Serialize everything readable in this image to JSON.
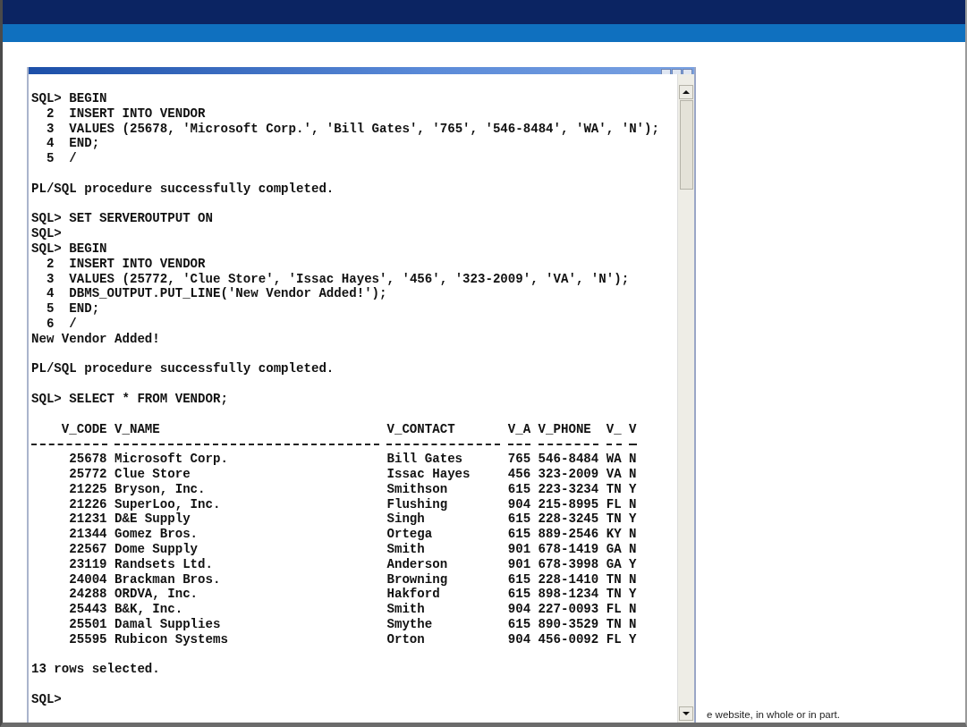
{
  "console": {
    "lines": [
      {
        "kind": "line",
        "text": "SQL> BEGIN"
      },
      {
        "kind": "line",
        "text": "  2  INSERT INTO VENDOR"
      },
      {
        "kind": "line",
        "text": "  3  VALUES (25678, 'Microsoft Corp.', 'Bill Gates', '765', '546-8484', 'WA', 'N');"
      },
      {
        "kind": "line",
        "text": "  4  END;"
      },
      {
        "kind": "line",
        "text": "  5  /"
      },
      {
        "kind": "blank"
      },
      {
        "kind": "line",
        "text": "PL/SQL procedure successfully completed."
      },
      {
        "kind": "blank"
      },
      {
        "kind": "line",
        "text": "SQL> SET SERVEROUTPUT ON"
      },
      {
        "kind": "line",
        "text": "SQL>"
      },
      {
        "kind": "line",
        "text": "SQL> BEGIN"
      },
      {
        "kind": "line",
        "text": "  2  INSERT INTO VENDOR"
      },
      {
        "kind": "line",
        "text": "  3  VALUES (25772, 'Clue Store', 'Issac Hayes', '456', '323-2009', 'VA', 'N');"
      },
      {
        "kind": "line",
        "text": "  4  DBMS_OUTPUT.PUT_LINE('New Vendor Added!');"
      },
      {
        "kind": "line",
        "text": "  5  END;"
      },
      {
        "kind": "line",
        "text": "  6  /"
      },
      {
        "kind": "line",
        "text": "New Vendor Added!"
      },
      {
        "kind": "blank"
      },
      {
        "kind": "line",
        "text": "PL/SQL procedure successfully completed."
      },
      {
        "kind": "blank"
      },
      {
        "kind": "line",
        "text": "SQL> SELECT * FROM VENDOR;"
      },
      {
        "kind": "blank"
      },
      {
        "kind": "table",
        "columns": [
          "V_CODE",
          "V_NAME",
          "V_CONTACT",
          "V_A",
          "V_PHONE",
          "V_",
          "V"
        ],
        "rows": [
          [
            "25678",
            "Microsoft Corp.",
            "Bill Gates",
            "765",
            "546-8484",
            "WA",
            "N"
          ],
          [
            "25772",
            "Clue Store",
            "Issac Hayes",
            "456",
            "323-2009",
            "VA",
            "N"
          ],
          [
            "21225",
            "Bryson, Inc.",
            "Smithson",
            "615",
            "223-3234",
            "TN",
            "Y"
          ],
          [
            "21226",
            "SuperLoo, Inc.",
            "Flushing",
            "904",
            "215-8995",
            "FL",
            "N"
          ],
          [
            "21231",
            "D&E Supply",
            "Singh",
            "615",
            "228-3245",
            "TN",
            "Y"
          ],
          [
            "21344",
            "Gomez Bros.",
            "Ortega",
            "615",
            "889-2546",
            "KY",
            "N"
          ],
          [
            "22567",
            "Dome Supply",
            "Smith",
            "901",
            "678-1419",
            "GA",
            "N"
          ],
          [
            "23119",
            "Randsets Ltd.",
            "Anderson",
            "901",
            "678-3998",
            "GA",
            "Y"
          ],
          [
            "24004",
            "Brackman Bros.",
            "Browning",
            "615",
            "228-1410",
            "TN",
            "N"
          ],
          [
            "24288",
            "ORDVA, Inc.",
            "Hakford",
            "615",
            "898-1234",
            "TN",
            "Y"
          ],
          [
            "25443",
            "B&K, Inc.",
            "Smith",
            "904",
            "227-0093",
            "FL",
            "N"
          ],
          [
            "25501",
            "Damal Supplies",
            "Smythe",
            "615",
            "890-3529",
            "TN",
            "N"
          ],
          [
            "25595",
            "Rubicon Systems",
            "Orton",
            "904",
            "456-0092",
            "FL",
            "Y"
          ]
        ]
      },
      {
        "kind": "blank"
      },
      {
        "kind": "line",
        "text": "13 rows selected."
      },
      {
        "kind": "blank"
      },
      {
        "kind": "line",
        "text": "SQL>"
      }
    ]
  },
  "footer_note": "e website, in whole or in part."
}
